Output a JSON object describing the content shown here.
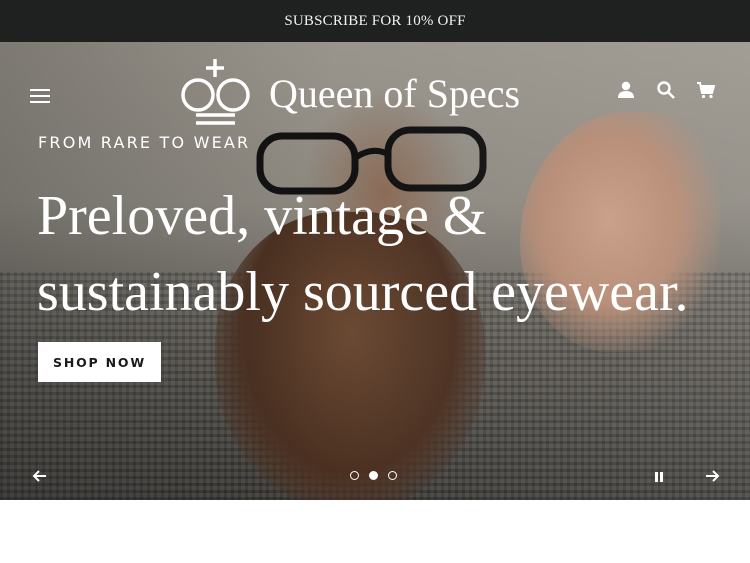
{
  "announcement": {
    "text": "SUBSCRIBE FOR 10% OFF"
  },
  "header": {
    "brand": "Queen of Specs",
    "icons": [
      "menu-icon",
      "account-icon",
      "search-icon",
      "cart-icon"
    ]
  },
  "hero": {
    "eyebrow": "FROM RARE TO WEAR",
    "headline_line1": "Preloved, vintage &",
    "headline_line2": "sustainably sourced eyewear.",
    "cta_label": "SHOP NOW"
  },
  "slideshow": {
    "slide_count": 3,
    "active_slide": 2,
    "controls": [
      "arrow-left-icon",
      "pause-icon",
      "arrow-right-icon"
    ]
  },
  "colors": {
    "announcement_bg": "#1f2020",
    "text_light": "#ffffff",
    "button_bg": "#ffffff",
    "button_text": "#1a1a1a"
  }
}
